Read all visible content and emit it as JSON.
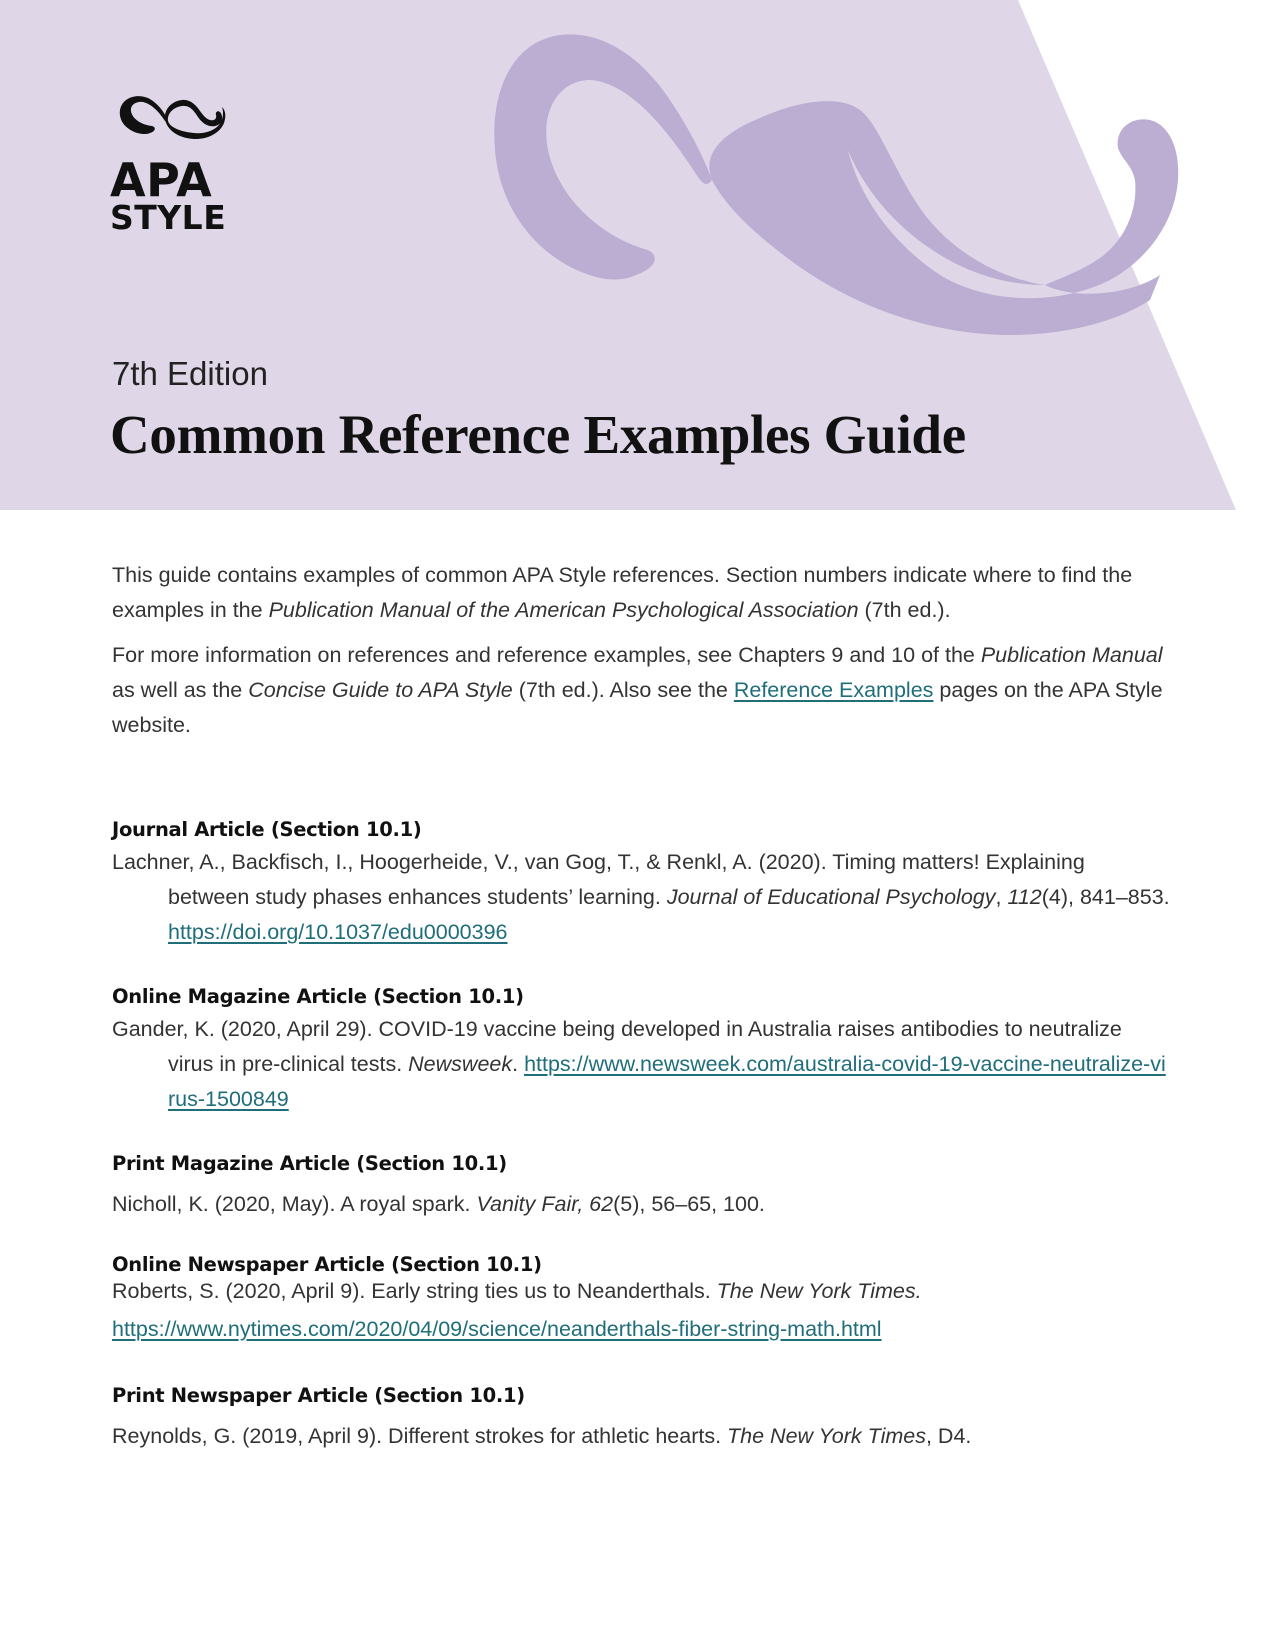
{
  "header": {
    "logo_line1": "APA",
    "logo_line2": "STYLE",
    "edition": "7th Edition",
    "title": "Common Reference Examples Guide",
    "colors": {
      "band": "#dfd7e8",
      "flourish": "#bcaed3",
      "text": "#111111"
    }
  },
  "intro": {
    "p1_a": "This guide contains examples of common APA Style references. Section numbers indicate where to find the examples in the ",
    "p1_em": "Publication Manual of the American Psychological Association",
    "p1_b": " (7th ed.).",
    "p2_a": "For more information on references and reference examples, see Chapters 9 and 10 of the ",
    "p2_em1": "Publication Manual",
    "p2_b": " as well as the ",
    "p2_em2": "Concise Guide to APA Style",
    "p2_c": " (7th ed.). Also see the ",
    "p2_link": "Reference Examples",
    "p2_d": " pages on the APA Style website."
  },
  "references": [
    {
      "heading": "Journal Article (Section 10.1)",
      "text_a": "Lachner, A., Backfisch, I., Hoogerheide, V., van Gog, T., & Renkl, A. (2020). Timing matters! Explaining between study phases enhances students’ learning. ",
      "em": "Journal of Educational Psychology",
      "text_b": ", ",
      "em2": "112",
      "text_c": "(4), 841–853. ",
      "link": "https://doi.org/10.1037/edu0000396"
    },
    {
      "heading": "Online Magazine Article (Section 10.1)",
      "text_a": "Gander, K. (2020, April 29). COVID-19 vaccine being developed in Australia raises antibodies to neutralize virus in pre-clinical tests. ",
      "em": "Newsweek",
      "text_b": ". ",
      "link": "https://www.newsweek.com/australia-covid-19-vaccine-neutralize-virus-1500849"
    },
    {
      "heading": "Print Magazine Article (Section 10.1)",
      "text_a": "Nicholl, K. (2020, May). A royal spark. ",
      "em": "Vanity Fair, 62",
      "text_b": "(5), 56–65, 100."
    },
    {
      "heading": "Online Newspaper Article (Section 10.1)",
      "text_a": "Roberts, S. (2020, April 9). Early string ties us to Neanderthals. ",
      "em": "The New York Times.",
      "link": "https://www.nytimes.com/2020/04/09/science/neanderthals-fiber-string-math.html"
    },
    {
      "heading": "Print Newspaper Article (Section 10.1)",
      "text_a": "Reynolds, G. (2019, April 9). Different strokes for athletic hearts. ",
      "em": "The New York Times",
      "text_b": ", D4."
    }
  ]
}
